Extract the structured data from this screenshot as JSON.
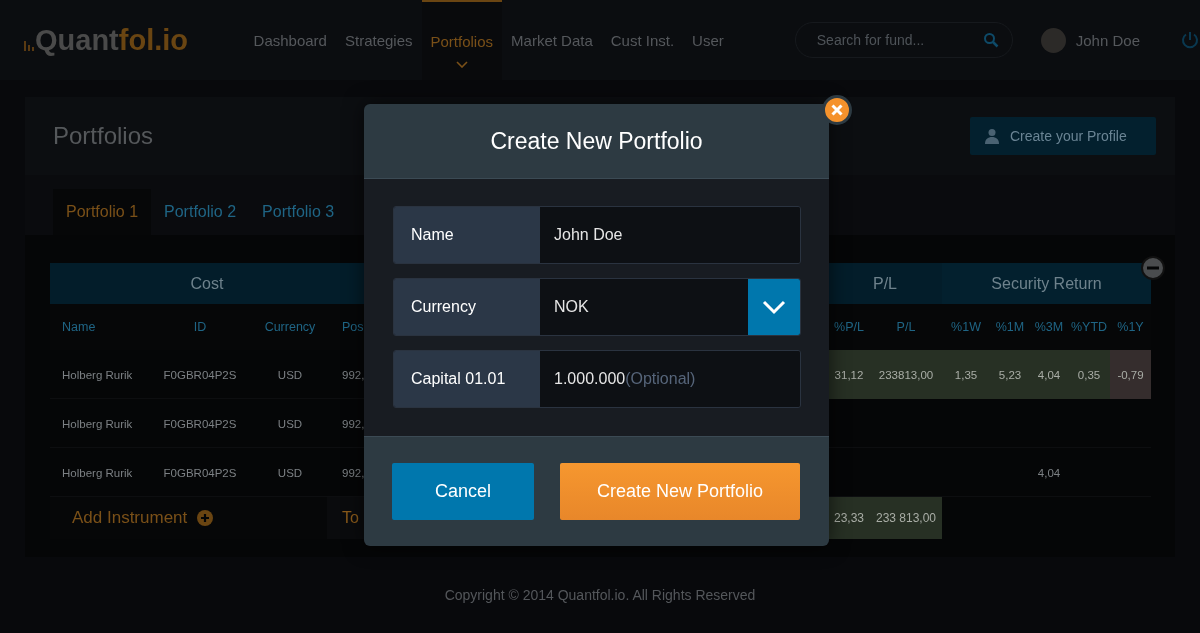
{
  "brand": {
    "lead": "Quant",
    "accent": "fol.io"
  },
  "nav": [
    {
      "label": "Dashboard",
      "selected": false
    },
    {
      "label": "Strategies",
      "selected": false
    },
    {
      "label": "Portfolios",
      "selected": true
    },
    {
      "label": "Market Data",
      "selected": false
    },
    {
      "label": "Cust Inst.",
      "selected": false
    },
    {
      "label": "User",
      "selected": false
    }
  ],
  "search": {
    "placeholder": "Search for fund..."
  },
  "user": {
    "name": "John Doe"
  },
  "page": {
    "title": "Portfolios",
    "profile_button": "Create your Profile"
  },
  "tabs": [
    {
      "label": "Portfolio 1",
      "selected": true
    },
    {
      "label": "Portfolio 2",
      "selected": false
    },
    {
      "label": "Portfolio 3",
      "selected": false
    }
  ],
  "table": {
    "groups": [
      {
        "label": "Cost"
      },
      {
        "label": "P/L"
      },
      {
        "label": "Security Return"
      }
    ],
    "columns": [
      {
        "label": "Name"
      },
      {
        "label": "ID"
      },
      {
        "label": "Currency"
      },
      {
        "label": "Pos"
      },
      {
        "label": "%P/L"
      },
      {
        "label": "P/L"
      },
      {
        "label": "%1W"
      },
      {
        "label": "%1M"
      },
      {
        "label": "%3M"
      },
      {
        "label": "%YTD"
      },
      {
        "label": "%1Y"
      }
    ],
    "rows": [
      {
        "cells": [
          {
            "text": "Holberg Rurik"
          },
          {
            "text": "F0GBR04P2S"
          },
          {
            "text": "USD"
          },
          {
            "text": "992,"
          },
          {
            "text": "31,12",
            "color": "#273024"
          },
          {
            "text": "233813,00",
            "color": "#273024"
          },
          {
            "text": "1,35",
            "color": "#273024"
          },
          {
            "text": "5,23",
            "color": "#273024"
          },
          {
            "text": "4,04",
            "color": "#273024"
          },
          {
            "text": "0,35",
            "color": "#273024"
          },
          {
            "text": "-0,79",
            "color": "#352d2d"
          }
        ]
      },
      {
        "cells": [
          {
            "text": "Holberg Rurik"
          },
          {
            "text": "F0GBR04P2S"
          },
          {
            "text": "USD"
          },
          {
            "text": "992,"
          }
        ]
      },
      {
        "cells": [
          {
            "text": "Holberg Rurik"
          },
          {
            "text": "F0GBR04P2S"
          },
          {
            "text": "USD"
          },
          {
            "text": "992,"
          },
          null,
          null,
          null,
          null,
          {
            "text": "4,04"
          }
        ]
      }
    ],
    "footer": {
      "add_label": "Add Instrument",
      "total_label": "To",
      "cells": [
        {
          "text": "23,33",
          "color": "#273024"
        },
        {
          "text": "233 813,00",
          "color": "#273024"
        }
      ]
    }
  },
  "modal": {
    "title": "Create New Portfolio",
    "fields": [
      {
        "kind": "text",
        "label": "Name",
        "value": "John Doe"
      },
      {
        "kind": "select",
        "label": "Currency",
        "value": "NOK"
      },
      {
        "kind": "text",
        "label": "Capital 01.01",
        "value": "1.000.000",
        "hint": "(Optional)"
      }
    ],
    "buttons": [
      {
        "kind": "secondary",
        "label": "Cancel"
      },
      {
        "kind": "primary",
        "label": "Create New Portfolio"
      }
    ]
  },
  "copyright": "Copyright © 2014 Quantfol.io. All Rights Reserved"
}
